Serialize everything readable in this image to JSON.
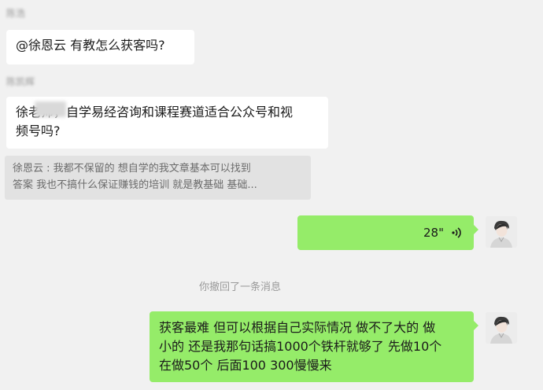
{
  "messages": {
    "sender1_name": "陈浩",
    "msg1": "@徐恩云 有教怎么获客吗?",
    "sender2_name": "陈凯辉",
    "msg2_line1": "徐老师，自学易经咨询和课程赛道适合公众号和视",
    "msg2_line2": "频号吗?",
    "quote_line1": "徐恩云 : 我都不保留的 想自学的我文章基本可以找到",
    "quote_line2": "答案 我也不搞什么保证赚钱的培训 就是教基础 基础...",
    "voice_duration": "28\"",
    "recall_notice": "你撤回了一条消息",
    "msg3_line1": "获客最难 但可以根据自己实际情况 做不了大的 做",
    "msg3_line2": "小的 还是我那句话搞1000个铁杆就够了 先做10个",
    "msg3_line3": "在做50个 后面100 300慢慢来"
  },
  "colors": {
    "background": "#f1f1f1",
    "incoming_bubble": "#ffffff",
    "outgoing_bubble": "#95ec69",
    "quote_bg": "#e2e2e2"
  },
  "icons": [
    "voice-wave-icon",
    "avatar-image"
  ]
}
